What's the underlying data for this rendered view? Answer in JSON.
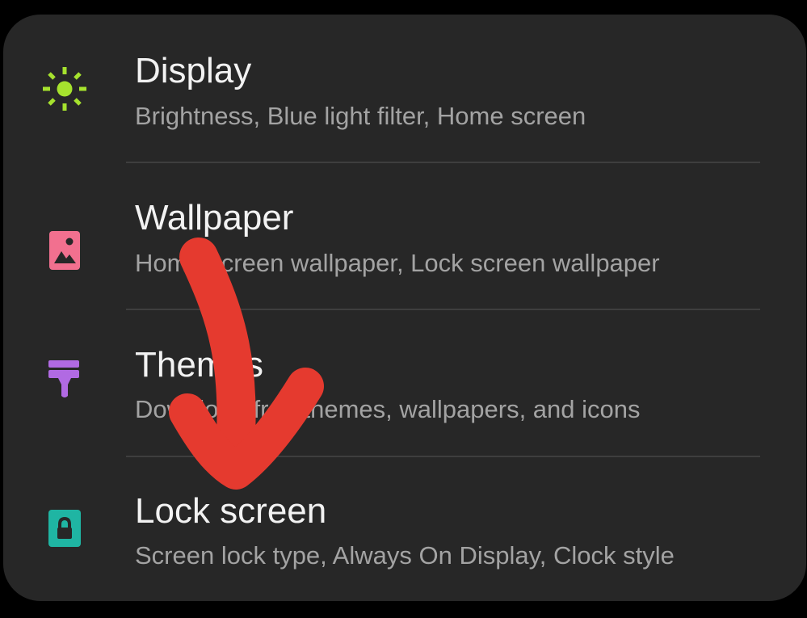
{
  "settings": {
    "items": [
      {
        "title": "Display",
        "subtitle": "Brightness, Blue light filter, Home screen",
        "icon": "sun-icon",
        "icon_color": "#a6e22e"
      },
      {
        "title": "Wallpaper",
        "subtitle": "Home screen wallpaper, Lock screen wallpaper",
        "icon": "image-icon",
        "icon_color": "#f2708f"
      },
      {
        "title": "Themes",
        "subtitle": "Download free themes, wallpapers, and icons",
        "icon": "paintbrush-icon",
        "icon_color": "#b16ae3"
      },
      {
        "title": "Lock screen",
        "subtitle": "Screen lock type, Always On Display, Clock style",
        "icon": "lock-icon",
        "icon_color": "#1fb5a3"
      }
    ]
  },
  "annotation": {
    "icon": "hand-drawn-arrow-icon",
    "color": "#e53a2f"
  }
}
